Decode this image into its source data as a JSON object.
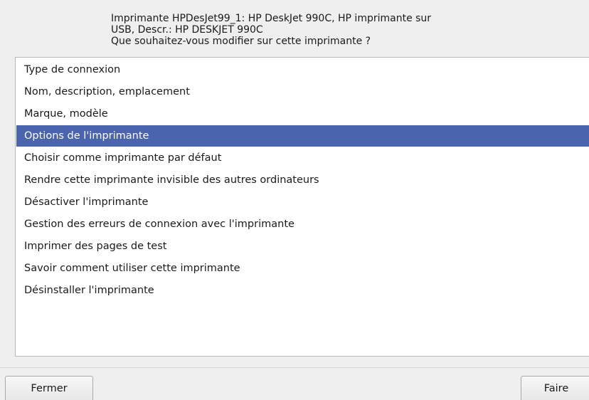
{
  "header": {
    "line1": "Imprimante HPDesJet99_1: HP DeskJet 990C, HP imprimante sur",
    "line2": "USB, Descr.: HP DESKJET 990C",
    "line3": "Que souhaitez-vous modifier sur cette imprimante ?"
  },
  "options": [
    "Type de connexion",
    "Nom, description, emplacement",
    "Marque, modèle",
    "Options de l'imprimante",
    "Choisir comme imprimante par défaut",
    "Rendre cette imprimante invisible des autres ordinateurs",
    "Désactiver l'imprimante",
    "Gestion des erreurs de connexion avec l'imprimante",
    "Imprimer des pages de test",
    "Savoir comment utiliser cette imprimante",
    "Désinstaller l'imprimante"
  ],
  "selected_option": "Options de l'imprimante",
  "buttons": {
    "close_label": "Fermer",
    "do_label": "Faire"
  },
  "colors": {
    "selection": "#4a64ad",
    "background": "#efefef"
  }
}
